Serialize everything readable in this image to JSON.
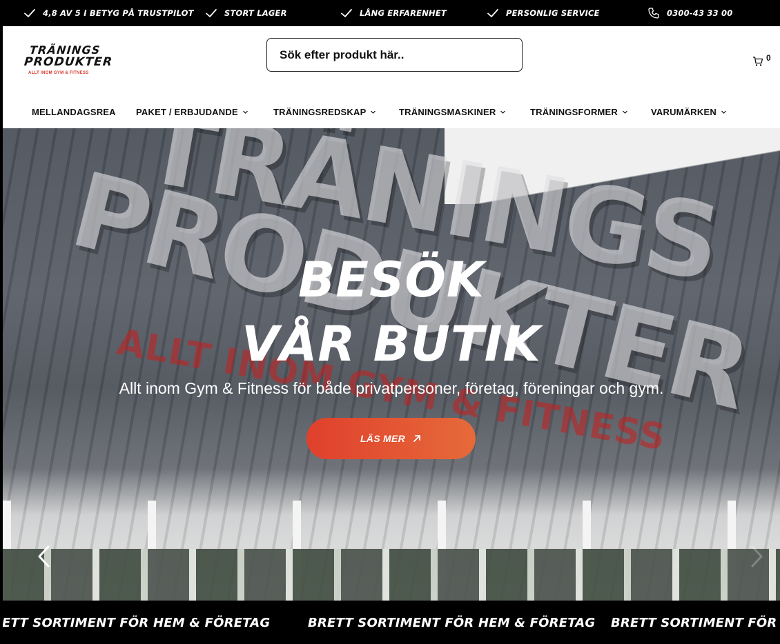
{
  "topbar": {
    "usps": [
      {
        "label": "4,8 AV 5 I BETYG PÅ TRUSTPILOT"
      },
      {
        "label": "STORT LAGER"
      },
      {
        "label": "LÅNG ERFARENHET"
      },
      {
        "label": "PERSONLIG SERVICE"
      }
    ],
    "phone": "0300-43 33 00"
  },
  "header": {
    "logo": {
      "line1": "TRÄNINGS",
      "line2": "PRODUKTER",
      "tagline": "ALLT INOM GYM & FITNESS"
    },
    "search": {
      "placeholder": "Sök efter produkt här.."
    },
    "cart": {
      "count": "0"
    }
  },
  "nav": {
    "items": [
      {
        "label": "MELLANDAGSREA"
      },
      {
        "label": "PAKET / ERBJUDANDE"
      },
      {
        "label": "TRÄNINGSREDSKAP"
      },
      {
        "label": "TRÄNINGSMASKINER"
      },
      {
        "label": "TRÄNINGSFORMER"
      },
      {
        "label": "VARUMÄRKEN"
      }
    ]
  },
  "hero": {
    "background_sign": {
      "line1": "TRÄNINGS",
      "line2": "PRODUKTER",
      "line3": "ALLT INOM GYM & FITNESS"
    },
    "title_line1": "BESÖK",
    "title_line2": "VÅR BUTIK",
    "subtitle": "Allt inom Gym & Fitness för både privatpersoner, företag, föreningar och gym.",
    "cta_label": "LÄS MER",
    "cta_colors": [
      "#e0402c",
      "#e66a3a"
    ]
  },
  "marquee": {
    "text": "BRETT SORTIMENT FÖR HEM & FÖRETAG"
  }
}
